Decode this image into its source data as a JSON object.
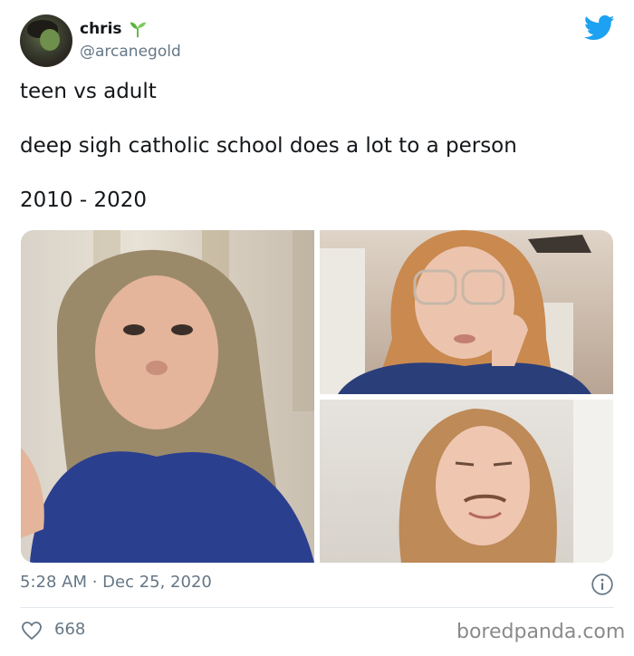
{
  "user": {
    "name": "chris",
    "handle": "@arcanegold",
    "badge_icon": "sprout-icon"
  },
  "tweet": {
    "lines": [
      "teen vs adult",
      "deep sigh catholic school does a lot to a person",
      "2010 - 2020"
    ],
    "timestamp": "5:28 AM · Dec 25, 2020",
    "likes": "668"
  },
  "photos": [
    "teen-photo",
    "adult-photo-glasses",
    "adult-photo-smiling"
  ],
  "watermark": "boredpanda.com",
  "colors": {
    "twitter_blue": "#1da1f2",
    "muted_text": "#657786",
    "sprout_green": "#5db33f"
  }
}
